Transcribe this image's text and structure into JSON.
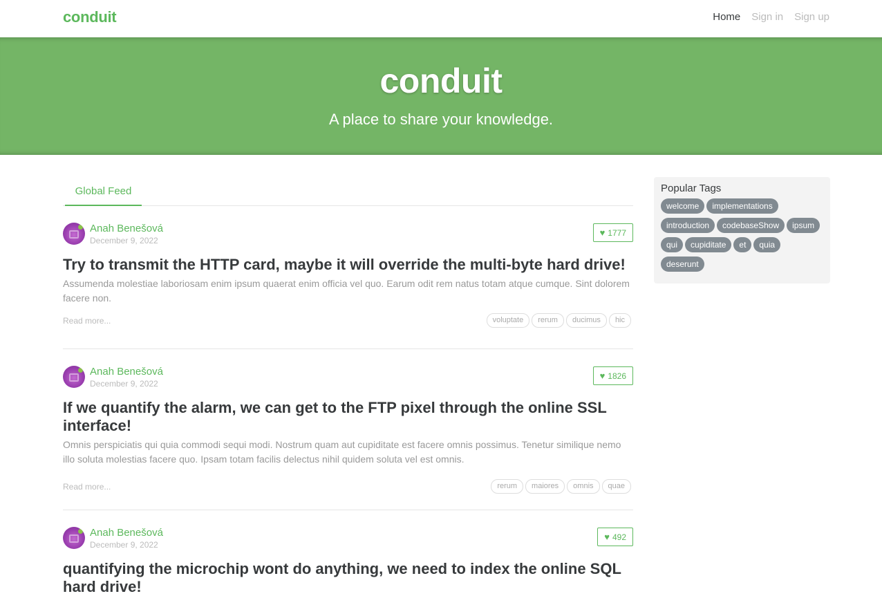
{
  "nav": {
    "brand": "conduit",
    "links": [
      {
        "label": "Home",
        "active": true
      },
      {
        "label": "Sign in",
        "active": false
      },
      {
        "label": "Sign up",
        "active": false
      }
    ]
  },
  "banner": {
    "title": "conduit",
    "subtitle": "A place to share your knowledge."
  },
  "feed": {
    "tab": "Global Feed",
    "articles": [
      {
        "author": "Anah Benešová",
        "date": "December 9, 2022",
        "likes": "1777",
        "title": "Try to transmit the HTTP card, maybe it will override the multi-byte hard drive!",
        "description": "Assumenda molestiae laboriosam enim ipsum quaerat enim officia vel quo. Earum odit rem natus totam atque cumque. Sint dolorem facere non.",
        "read_more": "Read more...",
        "tags": [
          "voluptate",
          "rerum",
          "ducimus",
          "hic"
        ]
      },
      {
        "author": "Anah Benešová",
        "date": "December 9, 2022",
        "likes": "1826",
        "title": "If we quantify the alarm, we can get to the FTP pixel through the online SSL interface!",
        "description": "Omnis perspiciatis qui quia commodi sequi modi. Nostrum quam aut cupiditate est facere omnis possimus. Tenetur similique nemo illo soluta molestias facere quo. Ipsam totam facilis delectus nihil quidem soluta vel est omnis.",
        "read_more": "Read more...",
        "tags": [
          "rerum",
          "maiores",
          "omnis",
          "quae"
        ]
      },
      {
        "author": "Anah Benešová",
        "date": "December 9, 2022",
        "likes": "492",
        "title": "quantifying the microchip wont do anything, we need to index the online SQL hard drive!"
      }
    ]
  },
  "sidebar": {
    "title": "Popular Tags",
    "tags": [
      "welcome",
      "implementations",
      "introduction",
      "codebaseShow",
      "ipsum",
      "qui",
      "cupiditate",
      "et",
      "quia",
      "deserunt"
    ]
  },
  "colors": {
    "brand_green": "#5cb85c",
    "banner_green": "#74b566",
    "tag_gray": "#818a91"
  }
}
